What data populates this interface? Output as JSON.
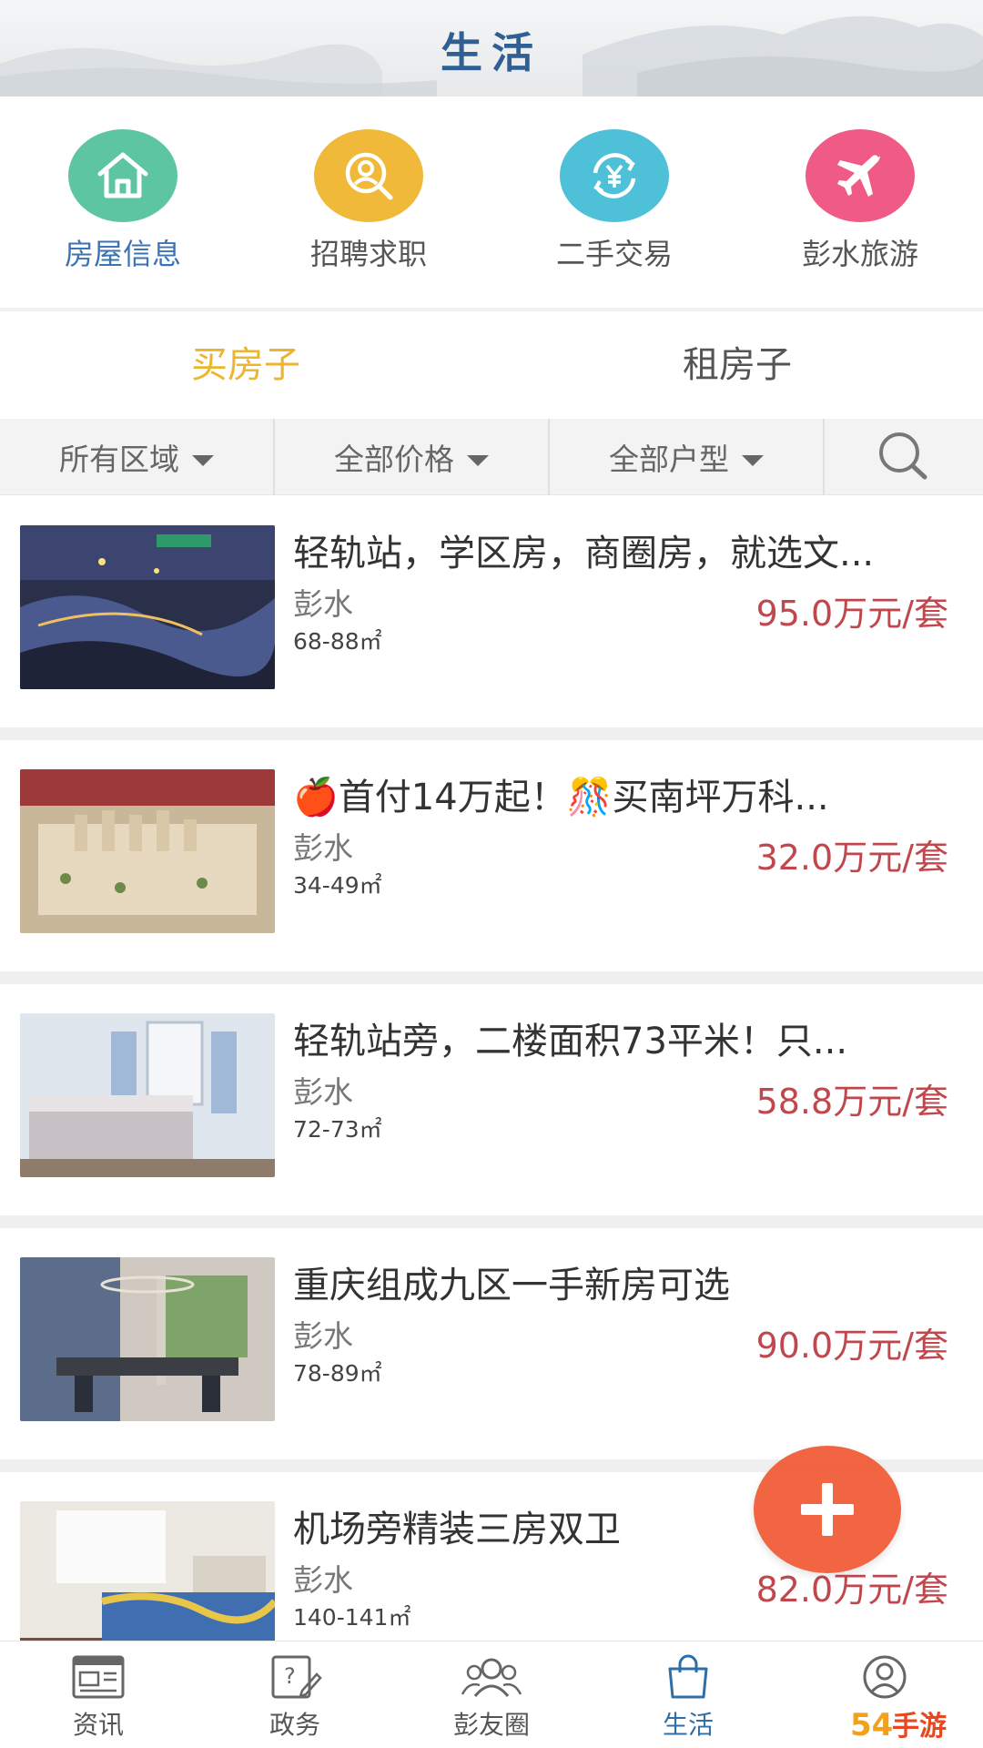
{
  "header": {
    "title": "生活"
  },
  "categories": [
    {
      "label": "房屋信息",
      "icon": "house-icon",
      "color": "#5ec5a2",
      "active": true
    },
    {
      "label": "招聘求职",
      "icon": "person-search-icon",
      "color": "#f0b93a",
      "active": false
    },
    {
      "label": "二手交易",
      "icon": "yuan-exchange-icon",
      "color": "#4ec1d9",
      "active": false
    },
    {
      "label": "彭水旅游",
      "icon": "airplane-icon",
      "color": "#ef5b86",
      "active": false
    }
  ],
  "tabs": [
    {
      "label": "买房子",
      "active": true
    },
    {
      "label": "租房子",
      "active": false
    }
  ],
  "filters": {
    "region": "所有区域",
    "price": "全部价格",
    "layout": "全部户型",
    "search_icon": "search-icon"
  },
  "listings": [
    {
      "title": "轻轨站，学区房，商圈房，就选文...",
      "location": "彭水",
      "area": "68-88㎡",
      "price": "95.0万元/套"
    },
    {
      "title": "🍎首付14万起！🎊买南坪万科...",
      "location": "彭水",
      "area": "34-49㎡",
      "price": "32.0万元/套"
    },
    {
      "title": "轻轨站旁，二楼面积73平米！只...",
      "location": "彭水",
      "area": "72-73㎡",
      "price": "58.8万元/套"
    },
    {
      "title": "重庆组成九区一手新房可选",
      "location": "彭水",
      "area": "78-89㎡",
      "price": "90.0万元/套"
    },
    {
      "title": "机场旁精装三房双卫",
      "location": "彭水",
      "area": "140-141㎡",
      "price": "82.0万元/套"
    }
  ],
  "fab": {
    "icon": "plus-icon"
  },
  "nav": [
    {
      "label": "资讯",
      "icon": "news-icon",
      "active": false
    },
    {
      "label": "政务",
      "icon": "government-icon",
      "active": false
    },
    {
      "label": "彭友圈",
      "icon": "friends-icon",
      "active": false
    },
    {
      "label": "生活",
      "icon": "shopping-bag-icon",
      "active": true
    },
    {
      "label": "",
      "icon": "profile-icon",
      "active": false
    }
  ],
  "colors": {
    "accent_tab": "#ecb52e",
    "price": "#c0474e",
    "nav_active": "#2f6fa8",
    "fab": "#f25a35"
  }
}
